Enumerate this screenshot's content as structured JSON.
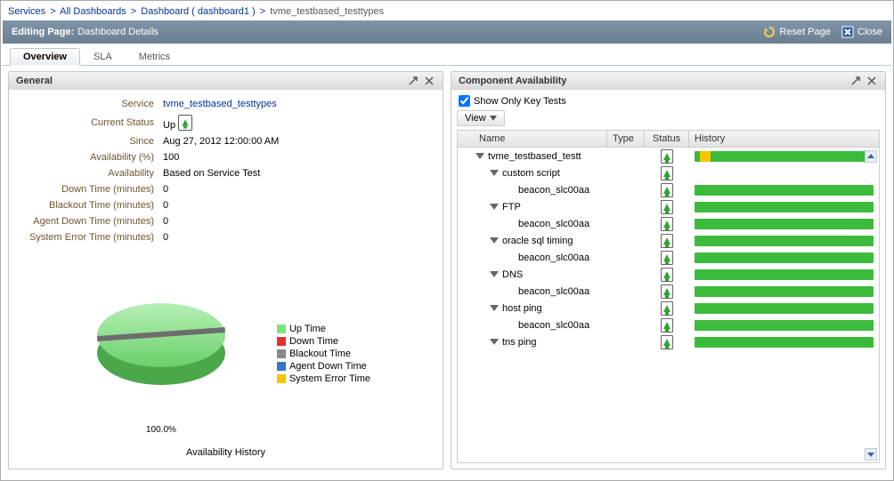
{
  "breadcrumb": {
    "items": [
      "Services",
      "All Dashboards",
      "Dashboard ( dashboard1 )"
    ],
    "current": "tvme_testbased_testtypes"
  },
  "editbar": {
    "editing": "Editing Page:",
    "subtitle": "Dashboard Details",
    "reset": "Reset Page",
    "close": "Close"
  },
  "tabs": [
    "Overview",
    "SLA",
    "Metrics"
  ],
  "active_tab": 0,
  "general": {
    "title": "General",
    "fields": {
      "service_label": "Service",
      "service_value": "tvme_testbased_testtypes",
      "status_label": "Current Status",
      "status_value": "Up",
      "since_label": "Since",
      "since_value": "Aug 27, 2012 12:00:00 AM",
      "avail_pct_label": "Availability (%)",
      "avail_pct_value": "100",
      "avail_label": "Availability",
      "avail_value": "Based on Service Test",
      "down_label": "Down Time (minutes)",
      "down_value": "0",
      "blackout_label": "Blackout Time (minutes)",
      "blackout_value": "0",
      "agent_label": "Agent Down Time (minutes)",
      "agent_value": "0",
      "syserr_label": "System Error Time (minutes)",
      "syserr_value": "0"
    },
    "chart": {
      "title": "Availability History",
      "pct_label": "100.0%",
      "legend": [
        {
          "label": "Up Time",
          "color": "#7fe27f"
        },
        {
          "label": "Down Time",
          "color": "#e03030"
        },
        {
          "label": "Blackout Time",
          "color": "#888888"
        },
        {
          "label": "Agent Down Time",
          "color": "#3974cc"
        },
        {
          "label": "System Error Time",
          "color": "#ffc400"
        }
      ]
    }
  },
  "component": {
    "title": "Component Availability",
    "show_only_label": "Show Only Key Tests",
    "view_label": "View",
    "columns": {
      "name": "Name",
      "type": "Type",
      "status": "Status",
      "history": "History"
    },
    "rows": [
      {
        "indent": 0,
        "tri": true,
        "name": "tvme_testbased_testt",
        "status": "up",
        "has_history": true,
        "yellow": true
      },
      {
        "indent": 1,
        "tri": true,
        "name": "custom script",
        "status": "up",
        "has_history": false
      },
      {
        "indent": 2,
        "tri": false,
        "name": "beacon_slc00aa",
        "status": "up",
        "has_history": true
      },
      {
        "indent": 1,
        "tri": true,
        "name": "FTP",
        "status": "up",
        "has_history": true
      },
      {
        "indent": 2,
        "tri": false,
        "name": "beacon_slc00aa",
        "status": "up",
        "has_history": true
      },
      {
        "indent": 1,
        "tri": true,
        "name": "oracle sql timing",
        "status": "up",
        "has_history": true
      },
      {
        "indent": 2,
        "tri": false,
        "name": "beacon_slc00aa",
        "status": "up",
        "has_history": true
      },
      {
        "indent": 1,
        "tri": true,
        "name": "DNS",
        "status": "up",
        "has_history": true
      },
      {
        "indent": 2,
        "tri": false,
        "name": "beacon_slc00aa",
        "status": "up",
        "has_history": true
      },
      {
        "indent": 1,
        "tri": true,
        "name": "host ping",
        "status": "up",
        "has_history": true
      },
      {
        "indent": 2,
        "tri": false,
        "name": "beacon_slc00aa",
        "status": "up",
        "has_history": true
      },
      {
        "indent": 1,
        "tri": true,
        "name": "tns ping",
        "status": "up",
        "has_history": true
      }
    ]
  },
  "chart_data": {
    "type": "pie",
    "title": "Availability History",
    "series": [
      {
        "name": "Up Time",
        "value": 100.0
      },
      {
        "name": "Down Time",
        "value": 0.0
      },
      {
        "name": "Blackout Time",
        "value": 0.0
      },
      {
        "name": "Agent Down Time",
        "value": 0.0
      },
      {
        "name": "System Error Time",
        "value": 0.0
      }
    ]
  }
}
